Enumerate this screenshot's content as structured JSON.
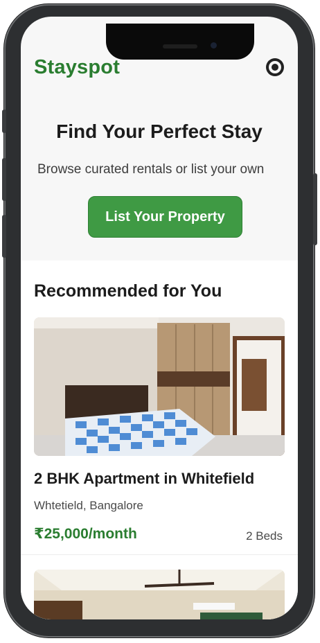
{
  "header": {
    "brand": "Stayspot",
    "settings_icon": "settings-icon"
  },
  "hero": {
    "title": "Find Your Perfect Stay",
    "subtitle": "Browse curated rentals or list your own",
    "cta_label": "List Your Property"
  },
  "recommended": {
    "title": "Recommended for You",
    "listings": [
      {
        "title": "2 BHK Apartment in Whitefield",
        "location": "Whtetield, Bangalore",
        "price": "₹25,000/month",
        "beds": "2 Beds"
      }
    ]
  },
  "colors": {
    "brand_green": "#2a7d30",
    "button_green": "#3f9a44"
  }
}
